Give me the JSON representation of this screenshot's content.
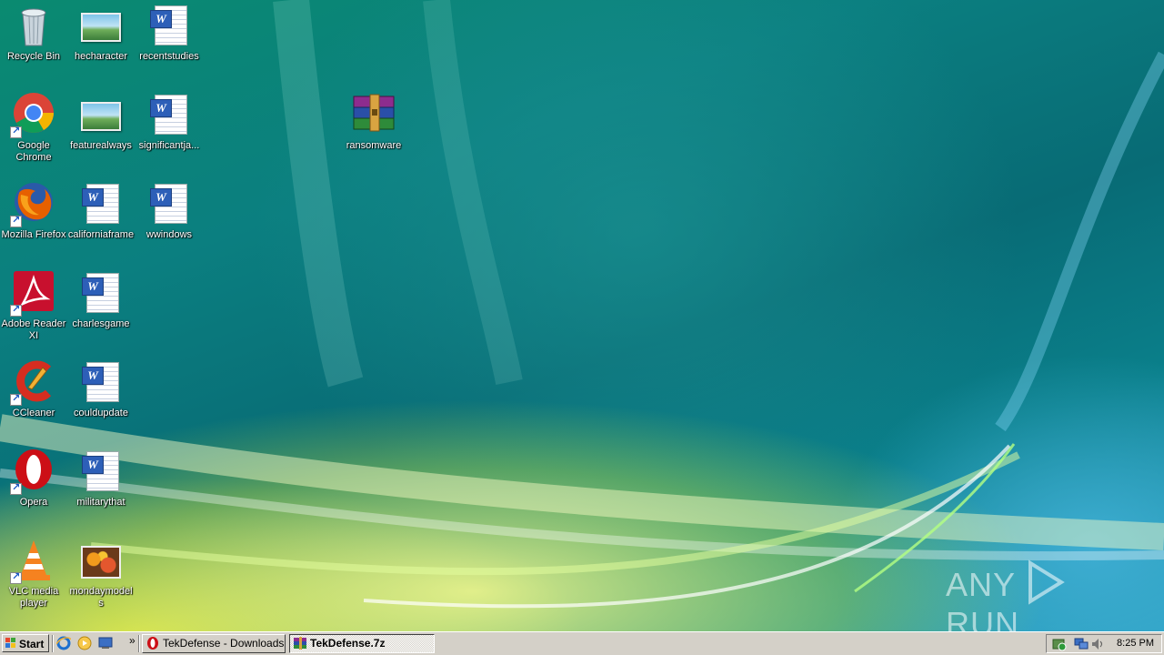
{
  "desktop": {
    "icons": {
      "recycle_bin": "Recycle Bin",
      "hecharacter": "hecharacter",
      "recentstudies": "recentstudies",
      "chrome": "Google Chrome",
      "featurealways": "featurealways",
      "significantja": "significantja...",
      "ransomware": "ransomware",
      "firefox": "Mozilla Firefox",
      "californiaframe": "californiaframe",
      "wwindows": "wwindows",
      "adobe": "Adobe Reader XI",
      "charlesgame": "charlesgame",
      "ccleaner": "CCleaner",
      "couldupdate": "couldupdate",
      "opera": "Opera",
      "militarythat": "militarythat",
      "vlc": "VLC media player",
      "mondaymodels": "mondaymodels"
    },
    "watermark": {
      "left": "ANY",
      "right": "RUN"
    }
  },
  "taskbar": {
    "start_label": "Start",
    "overflow": "»",
    "buttons": [
      {
        "label": "TekDefense - Downloads...",
        "active": false
      },
      {
        "label": "TekDefense.7z",
        "active": true
      }
    ],
    "clock": "8:25 PM"
  },
  "colors": {
    "taskbar": "#d4d0c8",
    "word_blue": "#2d5fb8",
    "desktop_teal": "#0b7f80"
  }
}
